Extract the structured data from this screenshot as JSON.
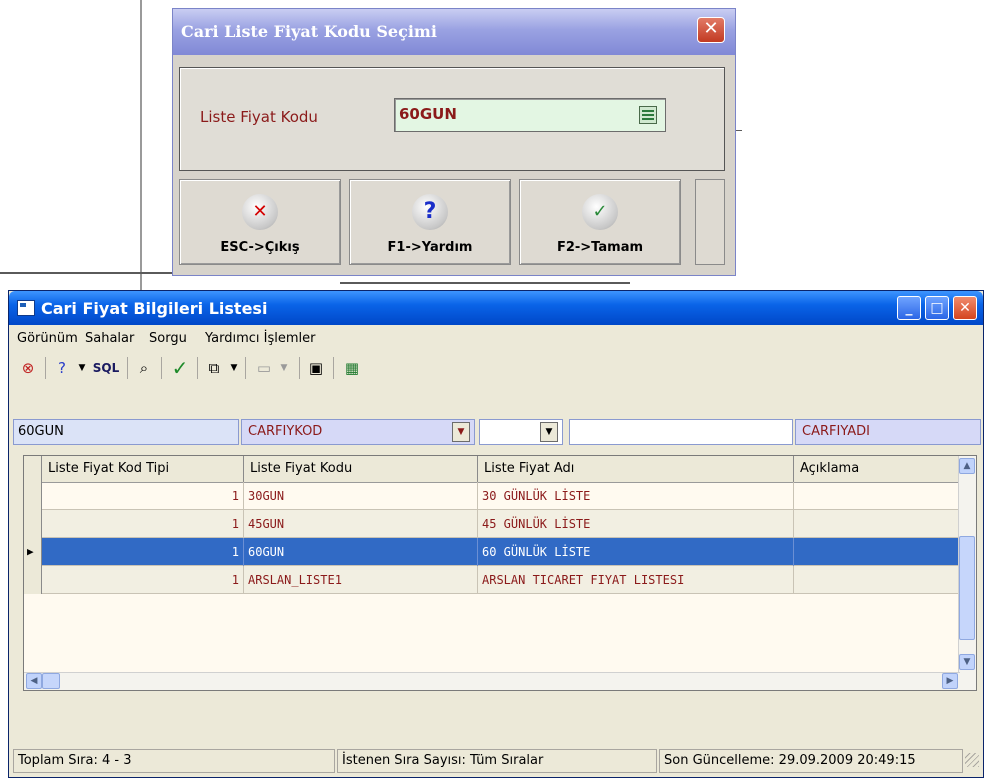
{
  "dialog": {
    "title": "Cari Liste Fiyat Kodu Seçimi",
    "close_glyph": "✕",
    "field_label": "Liste Fiyat Kodu",
    "field_value": "60GUN",
    "buttons": [
      {
        "label": "ESC->Çıkış",
        "icon": "cancel-x-icon",
        "glyph": "✕",
        "color": "#d40000"
      },
      {
        "label": "F1->Yardım",
        "icon": "help-question-icon",
        "glyph": "?",
        "color": "#1a2ec9"
      },
      {
        "label": "F2->Tamam",
        "icon": "ok-check-icon",
        "glyph": "✓",
        "color": "#2a8a3a"
      }
    ]
  },
  "window": {
    "title": "Cari Fiyat Bilgileri Listesi",
    "controls": {
      "minimize": "_",
      "maximize": "□",
      "close": "✕"
    },
    "menu": [
      "Görünüm",
      "Sahalar",
      "Sorgu",
      "Yardımcı İşlemler"
    ],
    "toolbar": {
      "sql_label": "SQL",
      "icons": [
        "cancel-icon",
        "help-icon",
        "sql-icon",
        "find-binoculars-icon",
        "check-icon",
        "copy-icon",
        "window-icon",
        "export-icon",
        "excel-icon"
      ]
    },
    "filter": {
      "search_value": "60GUN",
      "field_select": "CARFIYKOD",
      "operator_select": "",
      "value_input": "",
      "display_field": "CARFIYADI"
    },
    "grid": {
      "columns": [
        "Liste Fiyat Kod Tipi",
        "Liste Fiyat Kodu",
        "Liste Fiyat Adı",
        "Açıklama"
      ],
      "rows": [
        {
          "tip": "1",
          "kod": "30GUN",
          "ad": "30 GÜNLÜK LİSTE",
          "aciklama": ""
        },
        {
          "tip": "1",
          "kod": "45GUN",
          "ad": "45 GÜNLÜK LİSTE",
          "aciklama": ""
        },
        {
          "tip": "1",
          "kod": "60GUN",
          "ad": "60 GÜNLÜK LİSTE",
          "aciklama": ""
        },
        {
          "tip": "1",
          "kod": "ARSLAN_LISTE1",
          "ad": "ARSLAN TICARET FIYAT LISTESI",
          "aciklama": ""
        }
      ],
      "selected_row": 2
    },
    "status": {
      "total": "Toplam Sıra: 4 - 3",
      "requested": "İstenen Sıra Sayısı: Tüm Sıralar",
      "last_update": "Son Güncelleme: 29.09.2009 20:49:15"
    }
  }
}
